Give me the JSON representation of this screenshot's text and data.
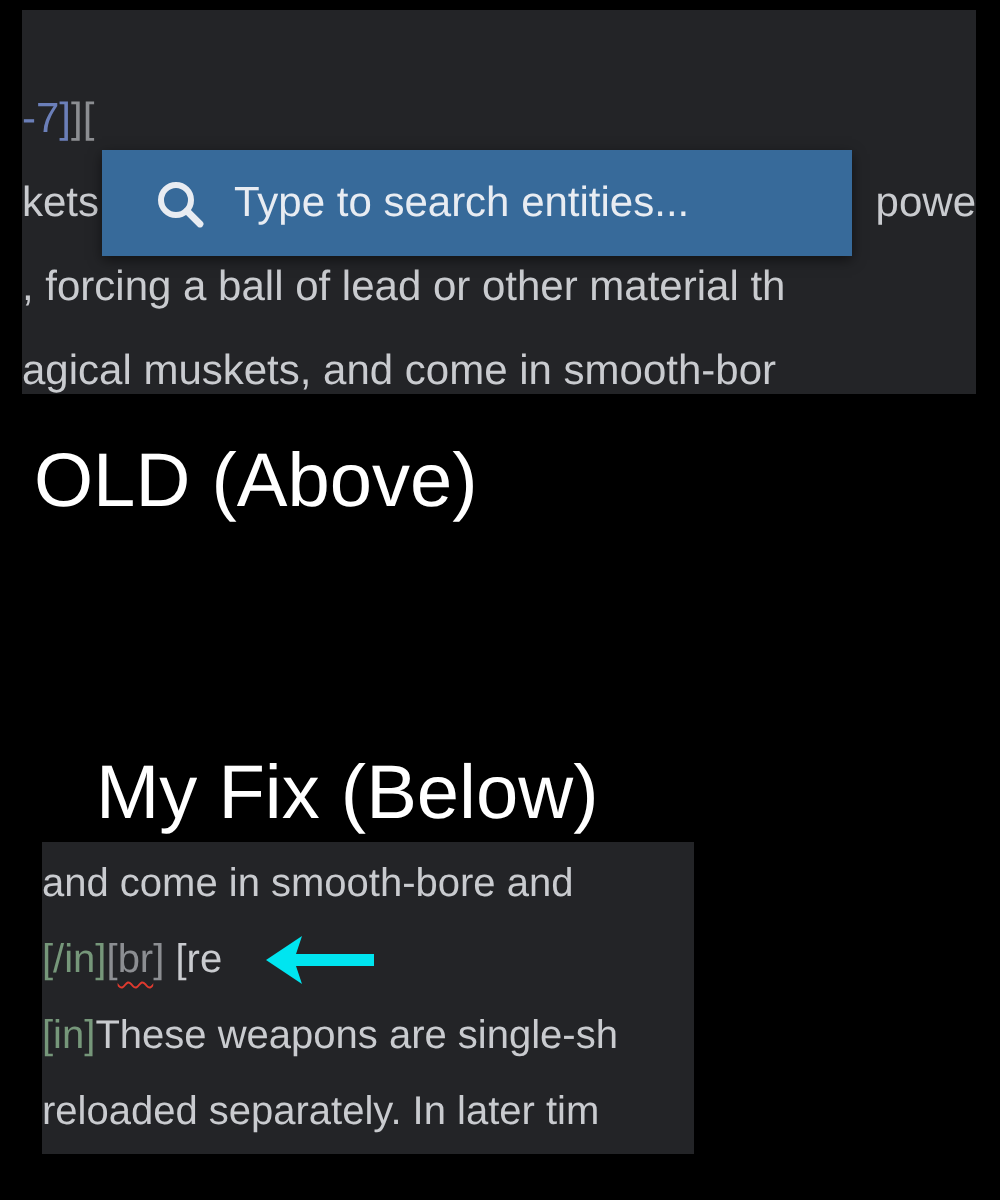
{
  "old_panel": {
    "lines": [
      [
        {
          "kind": "link",
          "text": "-7]"
        },
        {
          "kind": "bracket",
          "text": "]["
        }
      ],
      [
        {
          "kind": "text",
          "text": "kets"
        },
        {
          "kind": "text",
          "text": "powe"
        }
      ],
      [
        {
          "kind": "text",
          "text": ", forcing a ball of lead or other material th"
        }
      ],
      [
        {
          "kind": "text",
          "text": "agical muskets, and come in smooth-bor"
        }
      ]
    ],
    "search": {
      "placeholder": "Type to search entities..."
    }
  },
  "old_caption": "OLD (Above)",
  "fix_caption": "My Fix (Below)",
  "fix_panel": {
    "lines": [
      [
        {
          "kind": "text",
          "text": "and come in smooth-bore and"
        }
      ],
      [
        {
          "kind": "tag",
          "text": "[/in]"
        },
        {
          "kind": "bracket",
          "text": "["
        },
        {
          "kind": "misspelled",
          "text": "br"
        },
        {
          "kind": "bracket",
          "text": "]"
        },
        {
          "kind": "text",
          "text": " [re"
        }
      ],
      [
        {
          "kind": "tag",
          "text": "[in]"
        },
        {
          "kind": "text",
          "text": "These weapons are single-sh"
        }
      ],
      [
        {
          "kind": "text",
          "text": "reloaded separately. In later tim"
        }
      ]
    ]
  }
}
